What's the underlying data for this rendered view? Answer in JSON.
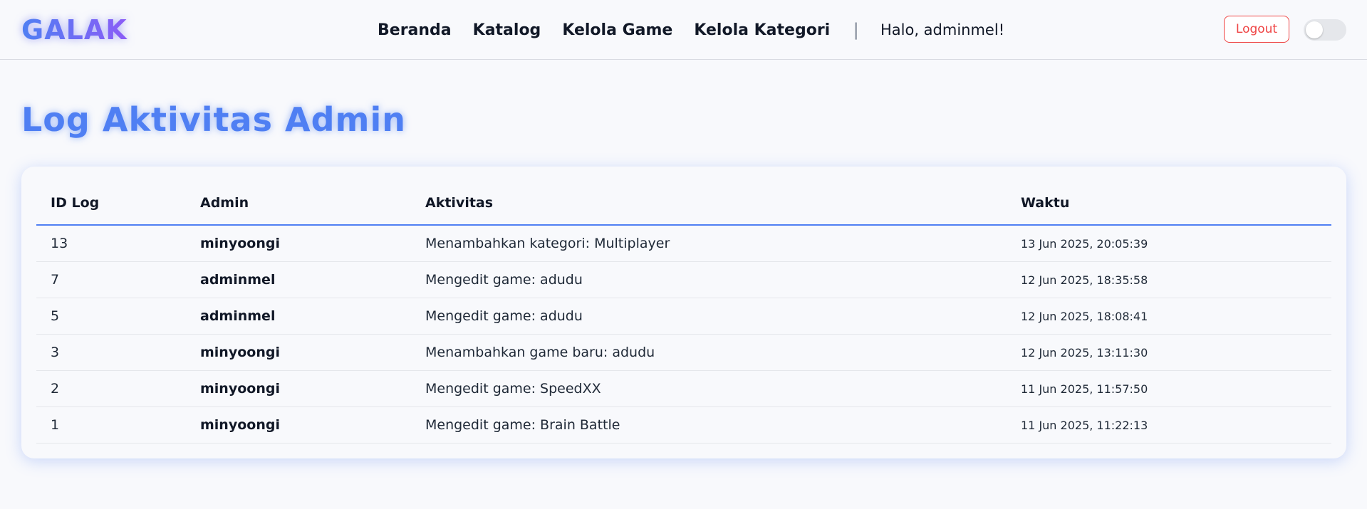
{
  "brand": {
    "logo_text": "GALAK"
  },
  "nav": {
    "links": [
      "Beranda",
      "Katalog",
      "Kelola Game",
      "Kelola Kategori"
    ],
    "separator": "|",
    "greeting": "Halo, adminmel!",
    "logout_label": "Logout",
    "theme_toggle": {
      "state": "off"
    }
  },
  "page": {
    "title": "Log Aktivitas Admin"
  },
  "table": {
    "headers": [
      "ID Log",
      "Admin",
      "Aktivitas",
      "Waktu"
    ],
    "rows": [
      [
        "13",
        "minyoongi",
        "Menambahkan kategori: Multiplayer",
        "13 Jun 2025, 20:05:39"
      ],
      [
        "7",
        "adminmel",
        "Mengedit game: adudu",
        "12 Jun 2025, 18:35:58"
      ],
      [
        "5",
        "adminmel",
        "Mengedit game: adudu",
        "12 Jun 2025, 18:08:41"
      ],
      [
        "3",
        "minyoongi",
        "Menambahkan game baru: adudu",
        "12 Jun 2025, 13:11:30"
      ],
      [
        "2",
        "minyoongi",
        "Mengedit game: SpeedXX",
        "11 Jun 2025, 11:57:50"
      ],
      [
        "1",
        "minyoongi",
        "Mengedit game: Brain Battle",
        "11 Jun 2025, 11:22:13"
      ]
    ]
  },
  "colors": {
    "accent": "#4f7ff3",
    "brand_gradient_end": "#8b5cf6",
    "logout": "#ef4444",
    "background": "#f8f9fc"
  }
}
